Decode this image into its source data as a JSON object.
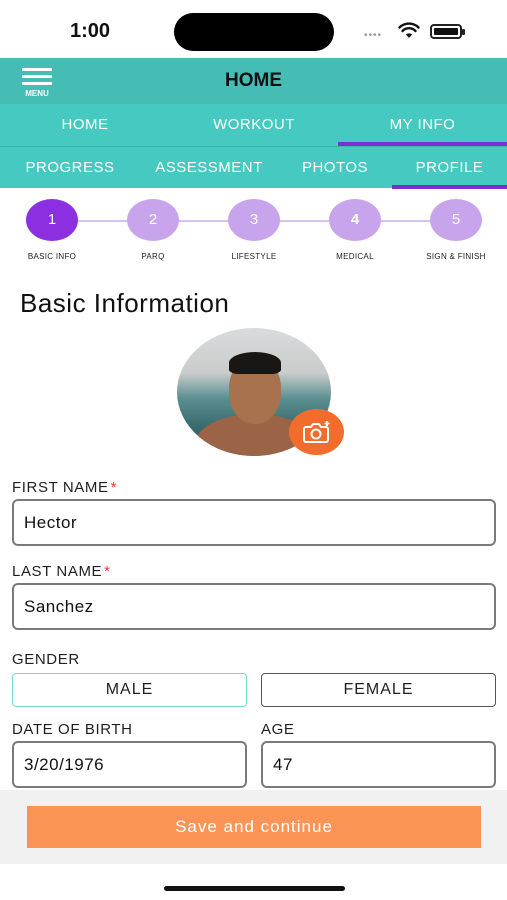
{
  "status_bar": {
    "time": "1:00",
    "dots": "••••"
  },
  "header": {
    "menu_label": "MENU",
    "title": "HOME"
  },
  "main_tabs": [
    {
      "label": "HOME",
      "active": false
    },
    {
      "label": "WORKOUT",
      "active": false
    },
    {
      "label": "MY INFO",
      "active": true
    }
  ],
  "sub_tabs": [
    {
      "label": "PROGRESS",
      "active": false
    },
    {
      "label": "ASSESSMENT",
      "active": false
    },
    {
      "label": "PHOTOS",
      "active": false
    },
    {
      "label": "PROFILE",
      "active": true
    }
  ],
  "stepper": [
    {
      "number": "1",
      "label": "BASIC INFO",
      "active": true
    },
    {
      "number": "2",
      "label": "PARQ",
      "active": false
    },
    {
      "number": "3",
      "label": "LIFESTYLE",
      "active": false
    },
    {
      "number": "4",
      "label": "MEDICAL",
      "active": false
    },
    {
      "number": "5",
      "label": "SIGN & FINISH",
      "active": false
    }
  ],
  "section_title": "Basic Information",
  "form": {
    "first_name_label": "FIRST NAME",
    "first_name_value": "Hector",
    "last_name_label": "LAST NAME",
    "last_name_value": "Sanchez",
    "required_mark": "*",
    "gender_label": "GENDER",
    "gender_options": [
      "MALE",
      "FEMALE"
    ],
    "gender_selected": "MALE",
    "dob_label": "DATE OF BIRTH",
    "dob_value": "3/20/1976",
    "age_label": "AGE",
    "age_value": "47"
  },
  "save_button_label": "Save and continue",
  "colors": {
    "header": "#45bdb4",
    "tabs": "#45c9c0",
    "active_indicator": "#7b2fd0",
    "step_active": "#8b2fe0",
    "step_inactive": "#c7a4ec",
    "camera_button": "#f26d2c",
    "save_button": "#fc9455"
  },
  "icons": {
    "menu": "hamburger-menu-icon",
    "wifi": "wifi-icon",
    "battery": "battery-icon",
    "camera": "camera-add-icon"
  }
}
